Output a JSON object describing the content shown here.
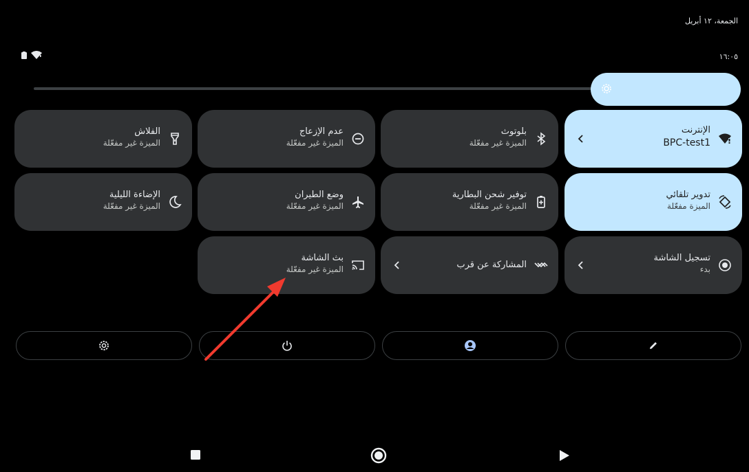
{
  "status": {
    "date": "الجمعة، ١٢ أبريل",
    "time": "١٦:٠٥"
  },
  "tiles": {
    "internet": {
      "title": "الإنترنت",
      "sub": "BPC-test1"
    },
    "bluetooth": {
      "title": "بلوتوث",
      "sub": "الميزة غير مفعّلة"
    },
    "dnd": {
      "title": "عدم الإزعاج",
      "sub": "الميزة غير مفعّلة"
    },
    "flashlight": {
      "title": "الفلاش",
      "sub": "الميزة غير مفعّلة"
    },
    "autorotate": {
      "title": "تدوير تلقائي",
      "sub": "الميزة مفعّلة"
    },
    "battery_saver": {
      "title": "توفير شحن البطارية",
      "sub": "الميزة غير مفعّلة"
    },
    "airplane": {
      "title": "وضع الطيران",
      "sub": "الميزة غير مفعّلة"
    },
    "night_light": {
      "title": "الإضاءة الليلية",
      "sub": "الميزة غير مفعّلة"
    },
    "screen_record": {
      "title": "تسجيل الشاشة",
      "sub": "بدء"
    },
    "nearby_share": {
      "title": "المشاركة عن قرب"
    },
    "cast": {
      "title": "بث الشاشة",
      "sub": "الميزة غير مفعّلة"
    }
  },
  "colors": {
    "tile_active": "#c2e7ff",
    "tile_inactive": "#303234",
    "annotation_arrow": "#f03a2e",
    "user_icon": "#a8c7fa"
  },
  "icons": [
    "wifi-icon",
    "battery-icon",
    "brightness-icon",
    "bluetooth-icon",
    "dnd-icon",
    "flashlight-icon",
    "rotate-icon",
    "battery-saver-icon",
    "airplane-icon",
    "moon-icon",
    "record-icon",
    "nearby-icon",
    "cast-icon",
    "settings-icon",
    "power-icon",
    "user-icon",
    "edit-icon",
    "recents-icon",
    "home-icon",
    "back-icon"
  ]
}
